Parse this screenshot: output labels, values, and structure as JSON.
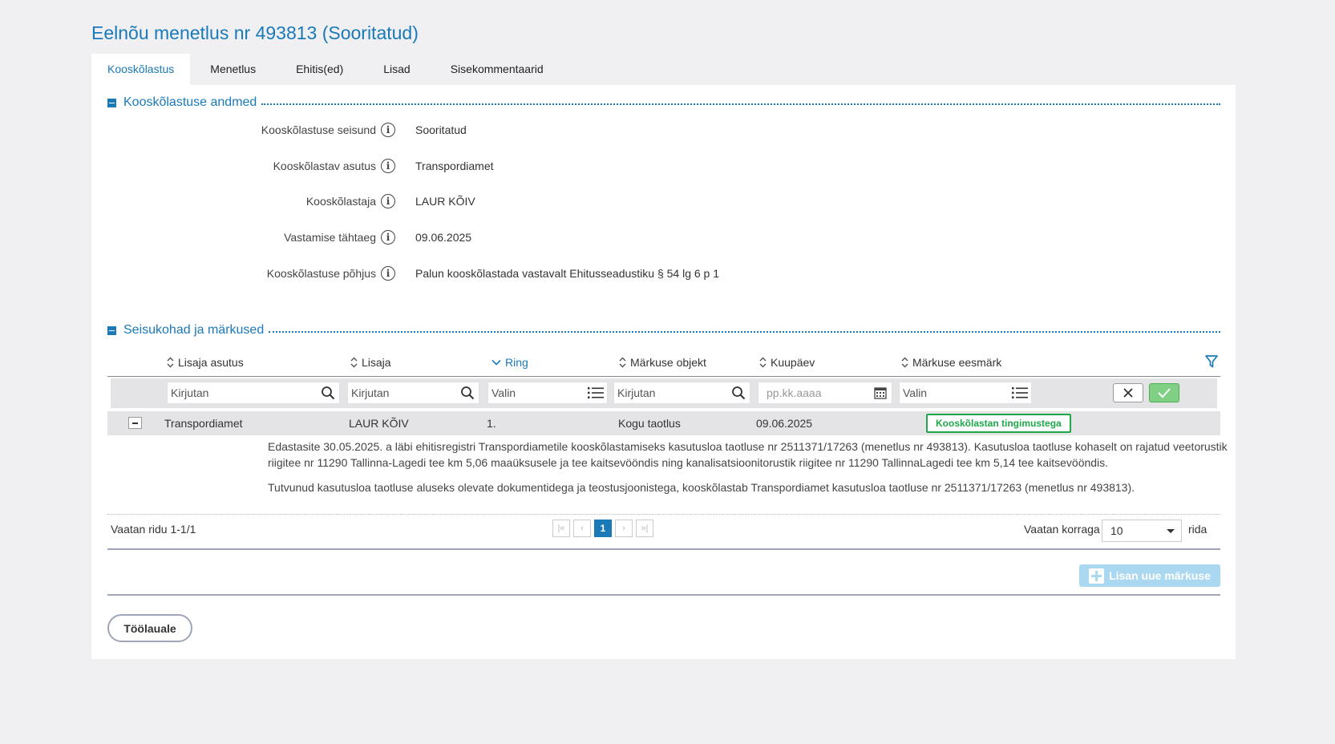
{
  "page": {
    "title": "Eelnõu menetlus nr 493813 (Sooritatud)"
  },
  "tabs": [
    {
      "label": "Kooskõlastus"
    },
    {
      "label": "Menetlus"
    },
    {
      "label": "Ehitis(ed)"
    },
    {
      "label": "Lisad"
    },
    {
      "label": "Sisekommentaarid"
    }
  ],
  "section1": {
    "title": "Kooskõlastuse andmed",
    "fields": [
      {
        "label": "Kooskõlastuse seisund",
        "value": "Sooritatud"
      },
      {
        "label": "Kooskõlastav asutus",
        "value": "Transpordiamet"
      },
      {
        "label": "Kooskõlastaja",
        "value": "LAUR KÕIV"
      },
      {
        "label": "Vastamise tähtaeg",
        "value": "09.06.2025"
      },
      {
        "label": "Kooskõlastuse põhjus",
        "value": "Palun kooskõlastada vastavalt Ehitusseadustiku § 54 lg 6 p 1"
      }
    ]
  },
  "section2": {
    "title": "Seisukohad ja märkused",
    "columns": [
      {
        "label": "Lisaja asutus"
      },
      {
        "label": "Lisaja"
      },
      {
        "label": "Ring"
      },
      {
        "label": "Märkuse objekt"
      },
      {
        "label": "Kuupäev"
      },
      {
        "label": "Märkuse eesmärk"
      }
    ],
    "filters": {
      "lisaja_asutus_placeholder": "Kirjutan",
      "lisaja_placeholder": "Kirjutan",
      "ring_placeholder": "Valin",
      "objekt_placeholder": "Kirjutan",
      "kuupaev_placeholder": "pp.kk.aaaa",
      "eesmark_placeholder": "Valin"
    },
    "rows": [
      {
        "asutus": "Transpordiamet",
        "lisaja": "LAUR KÕIV",
        "ring": "1.",
        "objekt": "Kogu taotlus",
        "kuupaev": "09.06.2025",
        "eesmark": "Kooskõlastan tingimustega",
        "text1": "Edastasite 30.05.2025. a läbi ehitisregistri Transpordiametile kooskõlastamiseks kasutusloa taotluse nr 2511371/17263 (menetlus nr 493813). Kasutusloa taotluse kohaselt on rajatud veetorustik riigitee nr 11290 Tallinna-Lagedi tee km 5,06 maaüksusele ja tee kaitsevööndis ning kanalisatsioonitorustik riigitee nr 11290 TallinnaLagedi tee km 5,14 tee kaitsevööndis.",
        "text2": "Tutvunud kasutusloa taotluse aluseks olevate dokumentidega ja teostusjoonistega, kooskõlastab Transpordiamet kasutusloa taotluse nr 2511371/17263 (menetlus nr 493813)."
      }
    ],
    "pager": {
      "info": "Vaatan ridu 1-1/1",
      "current_page": "1",
      "per_page_label": "Vaatan korraga",
      "per_page_value": "10",
      "rida_label": "rida"
    },
    "add_button": "Lisan uue märkuse"
  },
  "back_button": "Töölauale",
  "colors": {
    "accent": "#1a7ab8",
    "success": "#1ea84a",
    "background": "#f0f0f2"
  }
}
